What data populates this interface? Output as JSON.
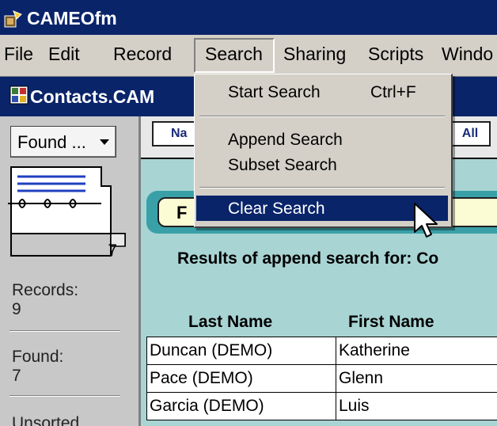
{
  "window": {
    "title": "CAMEOfm"
  },
  "menubar": {
    "items": [
      {
        "label": "File"
      },
      {
        "label": "Edit"
      },
      {
        "label": "Record"
      },
      {
        "label": "Search"
      },
      {
        "label": "Sharing"
      },
      {
        "label": "Scripts"
      },
      {
        "label": "Windo"
      }
    ]
  },
  "document": {
    "title": "Contacts.CAM"
  },
  "sidebar": {
    "found_dropdown": "Found ...",
    "record_number": "7",
    "records_label": "Records:",
    "records_value": "9",
    "found_label": "Found:",
    "found_value": "7",
    "sort_label": "Unsorted"
  },
  "tabs": [
    {
      "label": "Na"
    },
    {
      "label": "All"
    }
  ],
  "find_button": {
    "label": "F"
  },
  "results": {
    "heading": "Results of append search for: Co"
  },
  "table": {
    "columns": [
      "Last Name",
      "First Name"
    ],
    "rows": [
      [
        "Duncan (DEMO)",
        "Katherine"
      ],
      [
        "Pace (DEMO)",
        "Glenn"
      ],
      [
        "Garcia (DEMO)",
        "Luis"
      ]
    ]
  },
  "search_menu": {
    "items": [
      {
        "label": "Start Search",
        "shortcut": "Ctrl+F"
      },
      {
        "label": "Append Search",
        "shortcut": ""
      },
      {
        "label": "Subset Search",
        "shortcut": ""
      },
      {
        "label": "Clear Search",
        "shortcut": "",
        "highlighted": true
      }
    ]
  },
  "colors": {
    "titlebar": "#0a246a",
    "menu_highlight": "#0a246a",
    "content_bg": "#a8d4d4",
    "find_bar": "#3aa0a8",
    "find_button": "#fbfbd4"
  },
  "icons": {
    "app": "cameo-app-icon",
    "document": "document-window-icon",
    "book": "address-book-icon",
    "cursor": "mouse-pointer-icon"
  }
}
